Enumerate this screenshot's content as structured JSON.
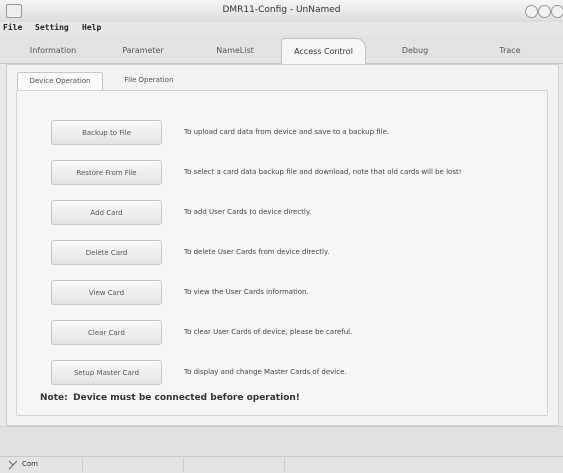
{
  "window": {
    "title": "DMR11-Config - UnNamed",
    "controls": [
      "minimize",
      "maximize",
      "close"
    ]
  },
  "menu": {
    "items": [
      "File",
      "Setting",
      "Help"
    ]
  },
  "tabs": [
    {
      "label": "Information",
      "active": false
    },
    {
      "label": "Parameter",
      "active": false
    },
    {
      "label": "NameList",
      "active": false
    },
    {
      "label": "Access Control",
      "active": true
    },
    {
      "label": "Debug",
      "active": false
    },
    {
      "label": "Trace",
      "active": false
    }
  ],
  "subtabs": [
    {
      "label": "Device Operation",
      "active": true
    },
    {
      "label": "File Operation",
      "active": false
    }
  ],
  "operations": [
    {
      "button": "Backup to File",
      "description": "To upload card data from device and save to a backup file."
    },
    {
      "button": "Restore From File",
      "description": "To select a card data backup file and download, note that old cards will be lost!"
    },
    {
      "button": "Add Card",
      "description": "To add User Cards to device directly."
    },
    {
      "button": "Delete Card",
      "description": "To delete User Cards from device directly."
    },
    {
      "button": "View Card",
      "description": "To view the User Cards information."
    },
    {
      "button": "Clear Card",
      "description": "To clear User Cards of device, please be careful."
    },
    {
      "button": "Setup Master Card",
      "description": "To display and change Master Cards of device."
    }
  ],
  "note": {
    "lead": "Note:",
    "text": "Device must be connected before operation!"
  },
  "status": {
    "port": "Com"
  }
}
